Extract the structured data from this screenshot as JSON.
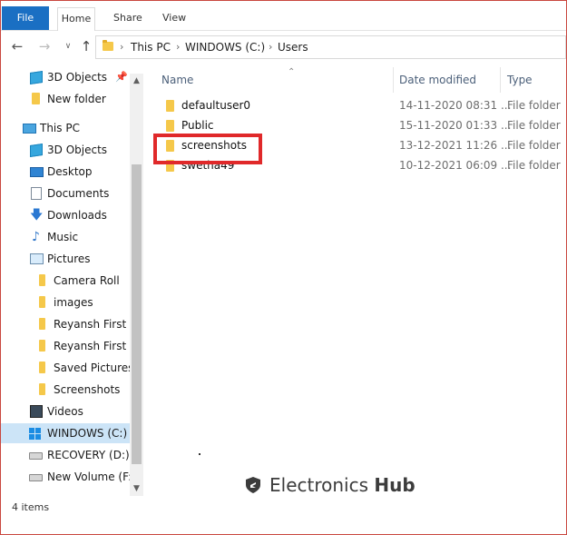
{
  "ribbon": {
    "tabs": [
      {
        "label": "File"
      },
      {
        "label": "Home"
      },
      {
        "label": "Share"
      },
      {
        "label": "View"
      }
    ]
  },
  "address": {
    "breadcrumbs": [
      "This PC",
      "WINDOWS (C:)",
      "Users"
    ]
  },
  "nav_pane": {
    "items": [
      {
        "label": "3D Objects",
        "icon": "cube-icon",
        "pinned": true
      },
      {
        "label": "New folder",
        "icon": "folder-icon"
      },
      {
        "label": "This PC",
        "icon": "pc-icon"
      },
      {
        "label": "3D Objects",
        "icon": "cube-icon"
      },
      {
        "label": "Desktop",
        "icon": "desktop-icon"
      },
      {
        "label": "Documents",
        "icon": "documents-icon"
      },
      {
        "label": "Downloads",
        "icon": "download-icon"
      },
      {
        "label": "Music",
        "icon": "music-icon"
      },
      {
        "label": "Pictures",
        "icon": "pictures-icon"
      },
      {
        "label": "Camera Roll",
        "icon": "folder-icon"
      },
      {
        "label": "images",
        "icon": "folder-icon"
      },
      {
        "label": "Reyansh First Bi",
        "icon": "folder-icon"
      },
      {
        "label": "Reyansh First Bi",
        "icon": "folder-icon"
      },
      {
        "label": "Saved Pictures",
        "icon": "folder-icon"
      },
      {
        "label": "Screenshots",
        "icon": "folder-icon"
      },
      {
        "label": "Videos",
        "icon": "videos-icon"
      },
      {
        "label": "WINDOWS (C:)",
        "icon": "windows-drive-icon",
        "selected": true
      },
      {
        "label": "RECOVERY (D:)",
        "icon": "drive-icon"
      },
      {
        "label": "New Volume (F:)",
        "icon": "drive-icon"
      }
    ]
  },
  "columns": {
    "name": "Name",
    "date": "Date modified",
    "type": "Type"
  },
  "files": [
    {
      "name": "defaultuser0",
      "date": "14-11-2020 08:31 ...",
      "type": "File folder"
    },
    {
      "name": "Public",
      "date": "15-11-2020 01:33 ...",
      "type": "File folder"
    },
    {
      "name": "screenshots",
      "date": "13-12-2021 11:26 ...",
      "type": "File folder",
      "highlighted": true
    },
    {
      "name": "swetha49",
      "date": "10-12-2021 06:09 ...",
      "type": "File folder"
    }
  ],
  "status": {
    "item_count": "4 items"
  },
  "watermark": {
    "brand_regular": "Electronics",
    "brand_bold": "Hub"
  },
  "colors": {
    "accent": "#1a6fc3",
    "folder": "#f5c84a",
    "highlight_box": "#e0292a",
    "selection": "#cce4f7"
  }
}
